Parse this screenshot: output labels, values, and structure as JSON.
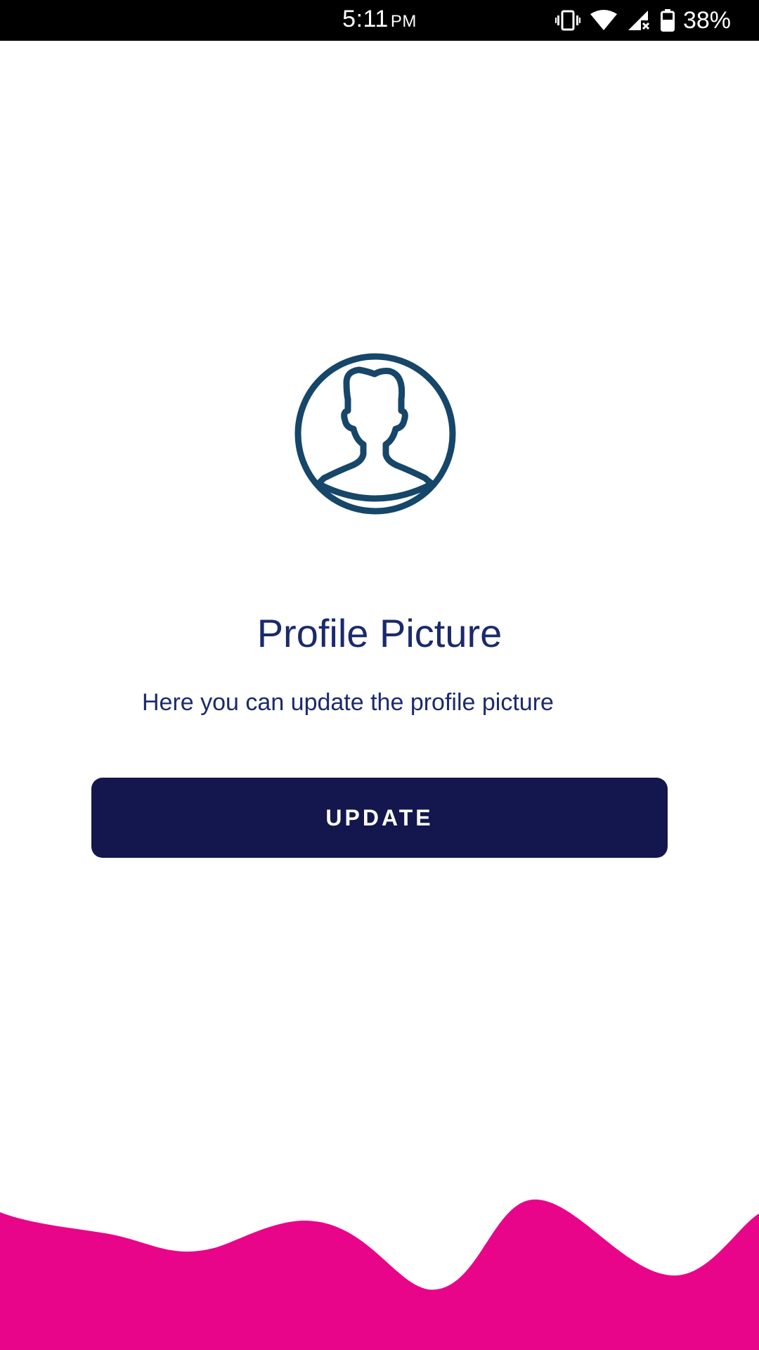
{
  "status_bar": {
    "time": "5:11",
    "ampm": "PM",
    "battery": "38%",
    "icons": [
      "vibrate-icon",
      "wifi-icon",
      "signal-no-data-icon",
      "battery-icon"
    ]
  },
  "main": {
    "avatar_icon": "user-silhouette-icon",
    "title": "Profile Picture",
    "subtitle": "Here you can update the profile picture",
    "update_label": "UPDATE"
  },
  "colors": {
    "status_bar": "#000000",
    "avatar": "#164669",
    "text": "#1b2a6b",
    "button": "#13174d",
    "wave": "#e8058a"
  }
}
